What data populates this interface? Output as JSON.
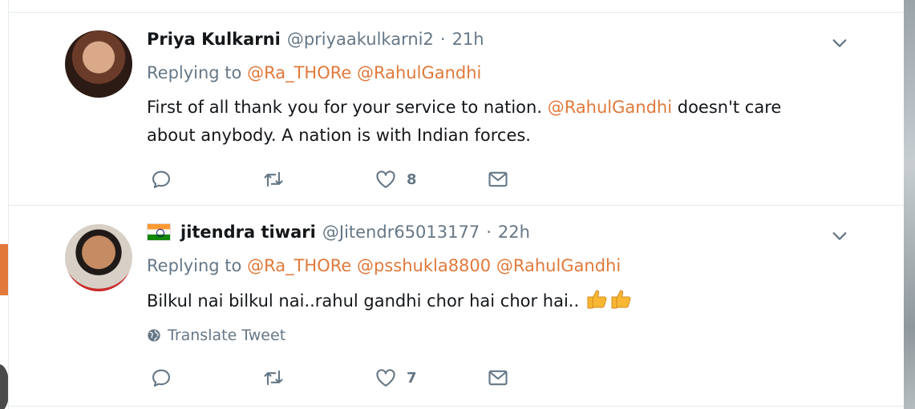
{
  "tweets": [
    {
      "name": "Priya Kulkarni",
      "handle": "@priyaakulkarni2",
      "separator": "·",
      "time": "21h",
      "replying_prefix": "Replying to",
      "replying_to": [
        "@Ra_THORe",
        "@RahulGandhi"
      ],
      "body_before": "First of all thank you for your service to nation. ",
      "body_mention": "@RahulGandhi",
      "body_after": " doesn't care about anybody. A nation is with Indian forces.",
      "like_count": "8"
    },
    {
      "name": "jitendra tiwari",
      "handle": "@Jitendr65013177",
      "separator": "·",
      "time": "22h",
      "replying_prefix": "Replying to",
      "replying_to": [
        "@Ra_THORe",
        "@psshukla8800",
        "@RahulGandhi"
      ],
      "body": "Bilkul nai bilkul nai..rahul gandhi chor hai chor hai..",
      "translate_label": "Translate Tweet",
      "like_count": "7"
    }
  ],
  "icons": {
    "reply": "reply-icon",
    "retweet": "retweet-icon",
    "like": "heart-icon",
    "dm": "envelope-icon",
    "caret": "chevron-down-icon",
    "globe": "globe-icon",
    "flag": "india-flag-icon",
    "thumbs": "thumbs-up-icon"
  },
  "colors": {
    "mention": "#e0793a",
    "secondary_text": "#657786",
    "primary_text": "#14171a"
  }
}
